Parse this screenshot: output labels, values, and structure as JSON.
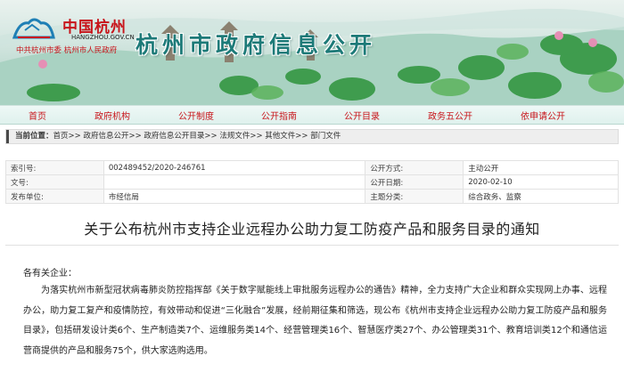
{
  "header": {
    "logo_cn": "中国杭州",
    "logo_en": "HANGZHOU.GOV.CN",
    "logo_sub": "中共杭州市委   杭州市人民政府",
    "site_title": "杭州市政府信息公开"
  },
  "nav": {
    "items": [
      "首页",
      "政府机构",
      "公开制度",
      "公开指南",
      "公开目录",
      "政务五公开",
      "依申请公开"
    ]
  },
  "breadcrumb": {
    "label": "当前位置：",
    "path": "首页>> 政府信息公开>> 政府信息公开目录>> 法规文件>> 其他文件>> 部门文件"
  },
  "meta": {
    "index_key": "索引号:",
    "index_value": "002489452/2020-246761",
    "method_key": "公开方式:",
    "method_value": "主动公开",
    "docno_key": "文号:",
    "docno_value": "",
    "date_key": "公开日期:",
    "date_value": "2020-02-10",
    "issuer_key": "发布单位:",
    "issuer_value": "市经信局",
    "topic_key": "主题分类:",
    "topic_value": "综合政务、监察"
  },
  "document": {
    "title": "关于公布杭州市支持企业远程办公助力复工防疫产品和服务目录的通知",
    "salutation": "各有关企业：",
    "body": "为落实杭州市新型冠状病毒肺炎防控指挥部《关于数字赋能线上审批服务远程办公的通告》精神，全力支持广大企业和群众实现网上办事、远程办公，助力复工复产和疫情防控，有效带动和促进“三化融合”发展，经前期征集和筛选，现公布《杭州市支持企业远程办公助力复工防疫产品和服务目录》，包括研发设计类6个、生产制造类7个、运维服务类14个、经营管理类16个、智慧医疗类27个、办公管理类31个、教育培训类12个和通信运营商提供的产品和服务75个，供大家选购选用。"
  },
  "colors": {
    "accent_red": "#c8151b",
    "title_teal": "#1d7a78"
  }
}
